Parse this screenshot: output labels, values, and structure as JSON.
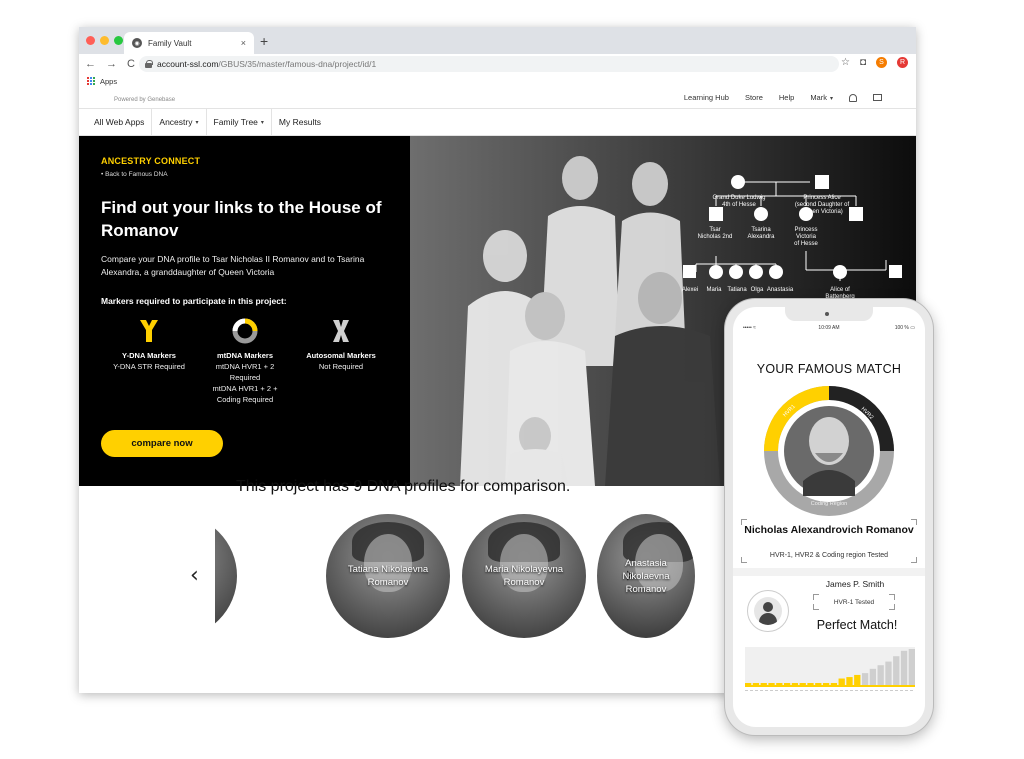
{
  "browser": {
    "tab_title": "Family Vault",
    "tab_close": "×",
    "new_tab": "+",
    "nav_back": "←",
    "nav_forward": "→",
    "nav_reload": "C",
    "url_host": "account-ssl.com",
    "url_path": "/GBUS/35/master/famous-dna/project/id/1",
    "ext_orange": "S",
    "ext_red": "R",
    "bookmarks_apps": "Apps"
  },
  "site": {
    "powered_by": "Powered by Genebase",
    "top_nav": [
      "Learning Hub",
      "Store",
      "Help",
      "Mark"
    ],
    "sub_nav": [
      {
        "label": "All Web Apps",
        "caret": false
      },
      {
        "label": "Ancestry",
        "caret": true
      },
      {
        "label": "Family Tree",
        "caret": true
      },
      {
        "label": "My Results",
        "caret": false
      }
    ],
    "caret_glyph": "▾"
  },
  "hero": {
    "eyebrow": "ANCESTRY CONNECT",
    "back_link": "• Back to Famous DNA",
    "title": "Find out your links to the House of Romanov",
    "description": "Compare your DNA profile to Tsar Nicholas II Romanov and to Tsarina Alexandra, a granddaughter of Queen Victoria",
    "markers_label": "Markers required to participate in this project:",
    "markers": [
      {
        "title": "Y-DNA Markers",
        "detail": [
          "Y-DNA STR Required"
        ],
        "icon": "y-chromosome-icon"
      },
      {
        "title": "mtDNA Markers",
        "detail": [
          "mtDNA HVR1 + 2",
          "Required",
          "mtDNA HVR1 + 2 +",
          "Coding Required"
        ],
        "icon": "mtdna-ring-icon"
      },
      {
        "title": "Autosomal Markers",
        "detail": [
          "Not Required"
        ],
        "icon": "x-chromosome-icon"
      }
    ],
    "cta_label": "compare now",
    "accent_color": "#ffd000",
    "tree": {
      "nodes": [
        {
          "label": [
            "Grand Duke Ludwig",
            "4th of Hesse"
          ]
        },
        {
          "label": [
            "Princess Alice",
            "(second Daughter of",
            "Queen Victoria)"
          ]
        },
        {
          "label": [
            "Tsar",
            "Nicholas 2nd"
          ]
        },
        {
          "label": [
            "Tsarina",
            "Alexandra"
          ]
        },
        {
          "label": [
            "Princess",
            "Victoria",
            "of Hesse"
          ]
        },
        {
          "label": [
            "Alexei"
          ]
        },
        {
          "label": [
            "Maria"
          ]
        },
        {
          "label": [
            "Tatiana"
          ]
        },
        {
          "label": [
            "Olga"
          ]
        },
        {
          "label": [
            "Anastasia"
          ]
        },
        {
          "label": [
            "Alice of",
            "Battenberg"
          ]
        }
      ]
    }
  },
  "profiles": {
    "heading": "This project has 9 DNA profiles for comparison.",
    "prev": "‹",
    "next": "›",
    "items": [
      {
        "name": "Tatiana Nikolaevna Romanov"
      },
      {
        "name": "Maria Nikolayevna Romanov"
      },
      {
        "name": "Anastasia Nikolaevna Romanov"
      }
    ]
  },
  "phone": {
    "status_time": "10:09 AM",
    "status_signal": "••••• ≈",
    "status_battery": "100 % ▭",
    "match_title": "YOUR FAMOUS MATCH",
    "ring_labels": [
      "HVR1",
      "HVR2",
      "Coding Region"
    ],
    "match_name": "Nicholas Alexandrovich Romanov",
    "match_tested": "HVR-1, HVR2 & Coding region Tested",
    "user_name": "James P. Smith",
    "user_tested": "HVR-1 Tested",
    "result": "Perfect Match!",
    "bar_values": [
      0,
      0,
      0,
      0,
      0,
      0,
      0,
      0,
      0,
      0,
      0,
      0,
      0.18,
      0.22,
      0.28,
      0.33,
      0.45,
      0.55,
      0.65,
      0.8,
      0.95,
      1.0
    ],
    "highlight_count": 15
  }
}
